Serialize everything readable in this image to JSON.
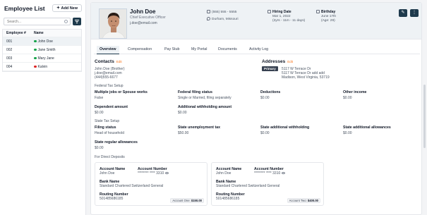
{
  "sidebar": {
    "title": "Employee List",
    "add_label": "Add New",
    "search_placeholder": "Search...",
    "columns": [
      "Employee #",
      "Name"
    ],
    "rows": [
      {
        "id": "001",
        "name": "John Doe",
        "status_color": "#16a34a"
      },
      {
        "id": "002",
        "name": "Jane Smith",
        "status_color": "#16a34a"
      },
      {
        "id": "003",
        "name": "Mary Jane",
        "status_color": "#16a34a"
      },
      {
        "id": "004",
        "name": "Kalvin",
        "status_color": "#dc2626"
      }
    ]
  },
  "profile": {
    "name": "John Doe",
    "role": "Chief Executive Officer",
    "email": "j.doe@email.com",
    "phone": "(555) 555 - 5555",
    "location": "Durham, Missouri",
    "hiring_label": "Hiring Date",
    "hiring_date": "Mar 1, 2022",
    "hiring_tenure": "(2yrs - 11m - 11 days)",
    "birthday_label": "Birthday",
    "birthday": "June 17th",
    "age": "(Age: 29)"
  },
  "tabs": [
    "Overview",
    "Compensation",
    "Pay Stub",
    "My Portal",
    "Documents",
    "Activity Log"
  ],
  "contacts": {
    "title": "Contacts",
    "edit": "Edit",
    "lines": [
      "John Doe (Brother)",
      "j.doe@email.com",
      "(444)555-6677"
    ]
  },
  "addresses": {
    "title": "Addresses",
    "edit": "Edit",
    "badge": "Primary",
    "line1": "5117 W Terrace Dr",
    "line2": "5117 W Terrace Dr add add",
    "line3": "Madison, West Virginia, 53719"
  },
  "federal": {
    "title": "Federal Tax Setup",
    "fields": [
      {
        "label": "Multiple jobs or Spouse works",
        "value": "False"
      },
      {
        "label": "Federal filing status",
        "value": "Single or Married, filing separately"
      },
      {
        "label": "Deductions",
        "value": "$0.00"
      },
      {
        "label": "Other income",
        "value": "$0.00"
      },
      {
        "label": "Dependent amount",
        "value": "$0.00"
      },
      {
        "label": "Additional withholding amount",
        "value": "$0.00"
      }
    ]
  },
  "state": {
    "title": "State Tax Setup",
    "fields": [
      {
        "label": "Filing status",
        "value": "Head of household"
      },
      {
        "label": "State unemployment tax",
        "value": "$50.00"
      },
      {
        "label": "State additional withholding",
        "value": "$0.00"
      },
      {
        "label": "State additional allowances",
        "value": "$0.00"
      },
      {
        "label": "State regular allowances",
        "value": "$0.00"
      }
    ]
  },
  "deposits": {
    "title": "For Direct Deposits",
    "cards": [
      {
        "acct_name_label": "Account Name",
        "acct_name": "John Doe",
        "acct_num_label": "Account Number",
        "acct_num": "******** **** 3310",
        "bank_label": "Bank Name",
        "bank": "Standard Chartered Switzerland General",
        "routing_label": "Routing Number",
        "routing": "501485686185",
        "badge_label": "Account One:",
        "badge_amount": "$150.00"
      },
      {
        "acct_name_label": "Account Name",
        "acct_name": "John Doe",
        "acct_num_label": "Account Number",
        "acct_num": "******** **** 3310",
        "bank_label": "Bank Name",
        "bank": "Standard Chartered Switzerland General",
        "routing_label": "Routing Number",
        "routing": "501485686185",
        "badge_label": "Account Two:",
        "badge_amount": "$400.00"
      }
    ]
  }
}
